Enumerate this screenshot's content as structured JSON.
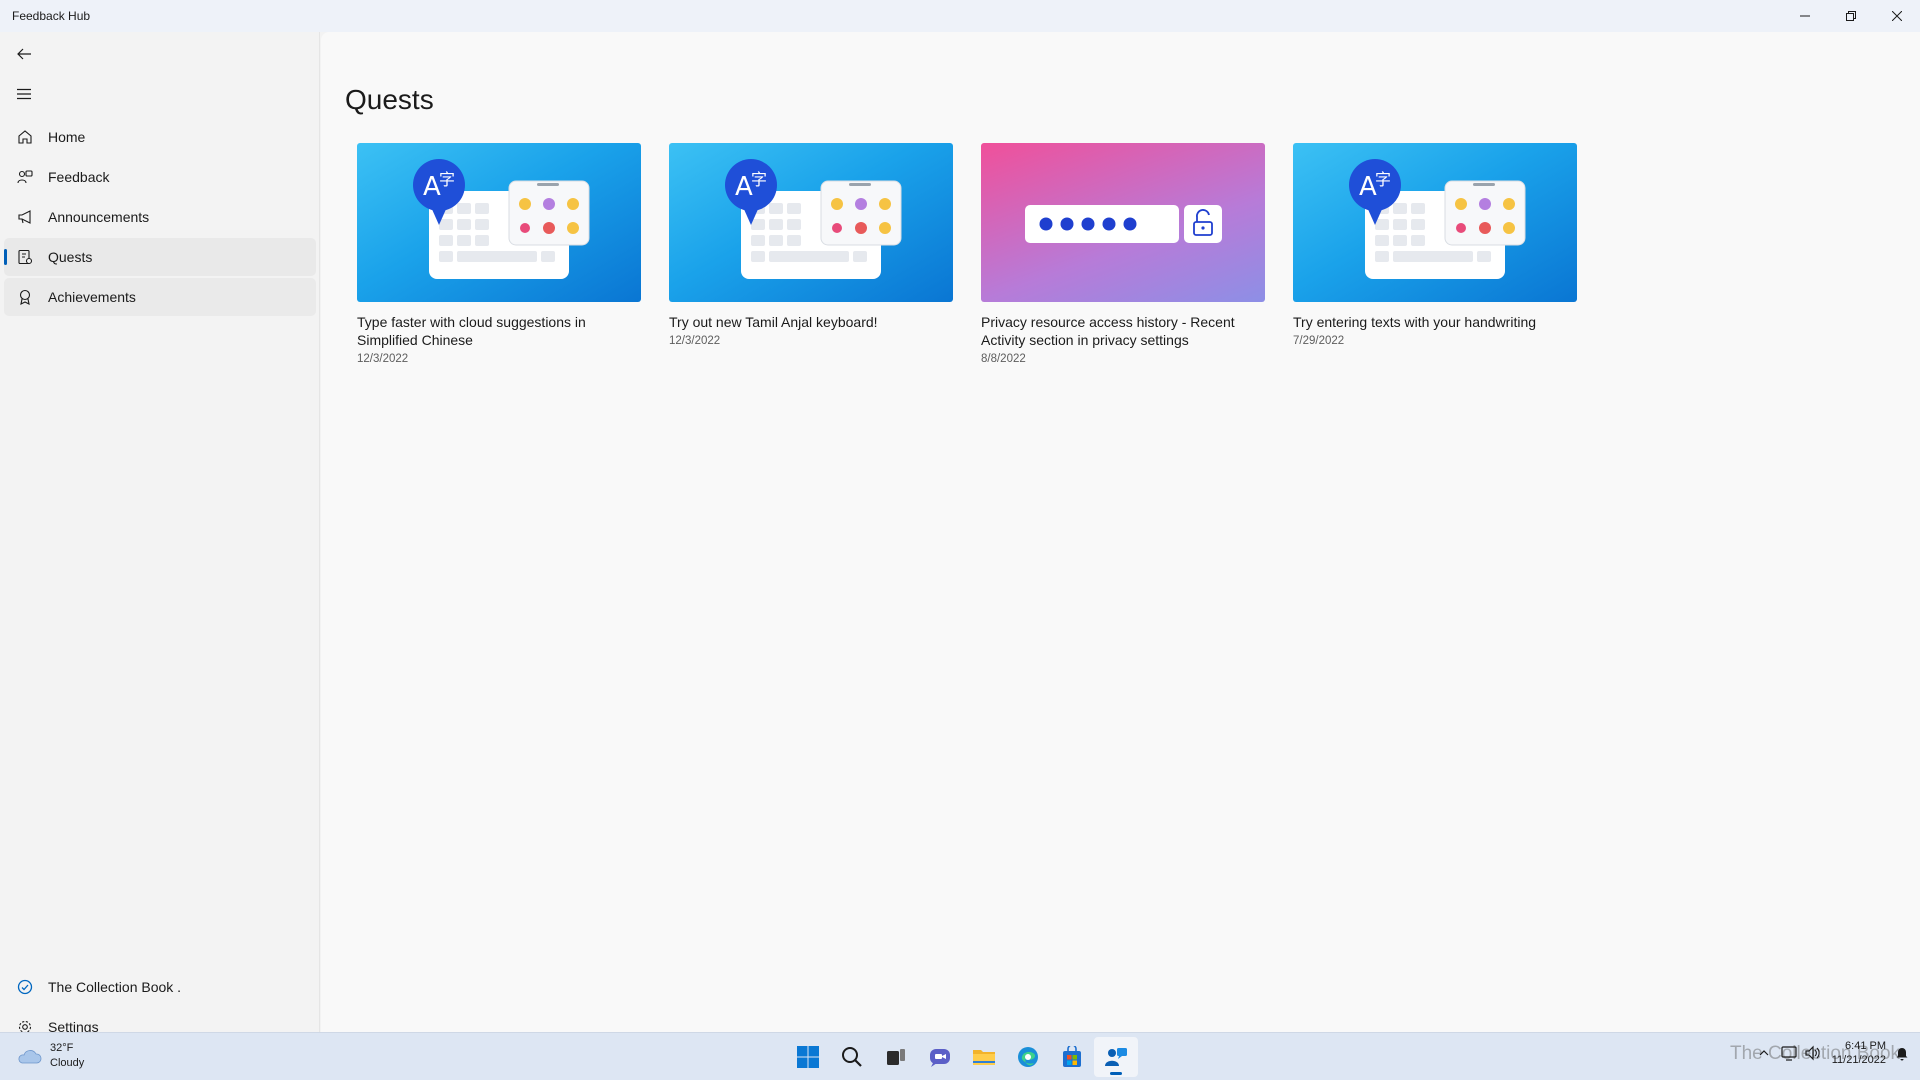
{
  "window": {
    "title": "Feedback Hub"
  },
  "sidebar": {
    "items": [
      {
        "label": "Home",
        "icon": "home-icon"
      },
      {
        "label": "Feedback",
        "icon": "feedback-icon"
      },
      {
        "label": "Announcements",
        "icon": "megaphone-icon"
      },
      {
        "label": "Quests",
        "icon": "quest-icon",
        "selected": true
      },
      {
        "label": "Achievements",
        "icon": "badge-icon"
      }
    ],
    "account_label": "The Collection Book .",
    "settings_label": "Settings"
  },
  "main": {
    "title": "Quests",
    "cards": [
      {
        "title": "Type faster with cloud suggestions in Simplified Chinese",
        "date": "12/3/2022",
        "image": "keyboard-ime-illustration"
      },
      {
        "title": "Try out new Tamil Anjal keyboard!",
        "date": "12/3/2022",
        "image": "keyboard-ime-illustration"
      },
      {
        "title": "Privacy resource access history - Recent Activity section in privacy settings",
        "date": "8/8/2022",
        "image": "password-lock-illustration"
      },
      {
        "title": "Try entering texts with your handwriting",
        "date": "7/29/2022",
        "image": "keyboard-ime-illustration"
      }
    ]
  },
  "taskbar": {
    "weather_temp": "32°F",
    "weather_desc": "Cloudy",
    "apps": [
      "start-icon",
      "search-icon",
      "task-view-icon",
      "chat-icon",
      "file-explorer-icon",
      "edge-icon",
      "store-icon",
      "feedback-hub-icon"
    ],
    "time": "6:41 PM",
    "date": "11/21/2022",
    "watermark": "The Collection Book"
  },
  "colors": {
    "accent": "#005fb8",
    "card_blue": "#1aa2ea",
    "card_pink": "#f0509a"
  }
}
